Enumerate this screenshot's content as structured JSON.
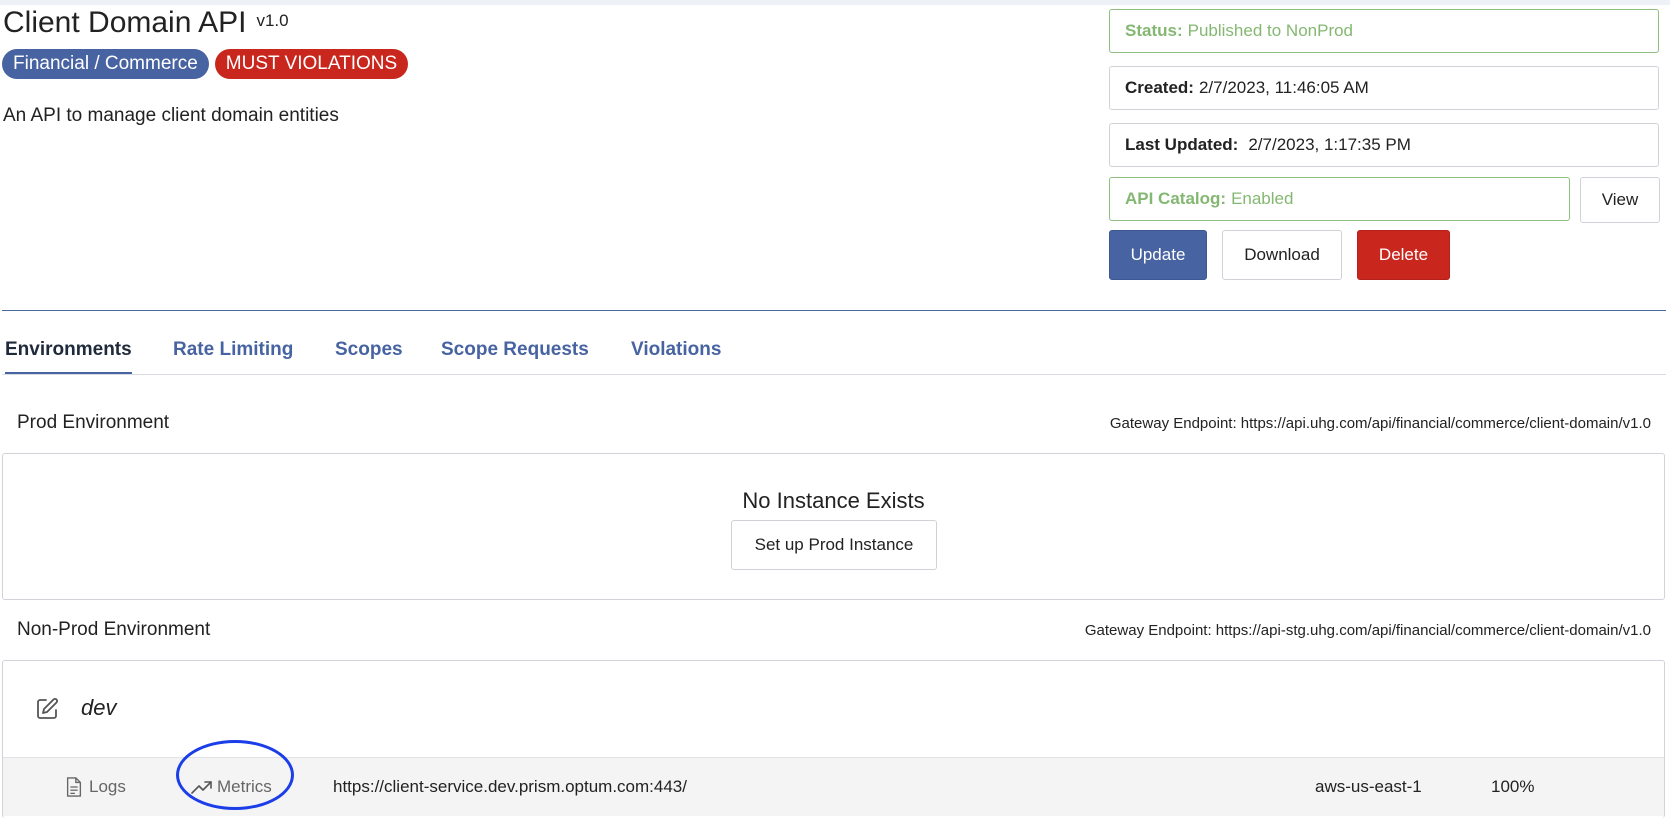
{
  "header": {
    "title": "Client Domain API",
    "version": "v1.0",
    "tags": [
      "Financial / Commerce",
      "MUST VIOLATIONS"
    ],
    "description": "An API to manage client domain entities"
  },
  "info": {
    "status_label": "Status:",
    "status_value": "Published to NonProd",
    "created_label": "Created:",
    "created_value": "2/7/2023, 11:46:05 AM",
    "updated_label": "Last Updated:",
    "updated_value": "2/7/2023, 1:17:35 PM",
    "catalog_label": "API Catalog:",
    "catalog_value": "Enabled",
    "view_label": "View"
  },
  "actions": {
    "update": "Update",
    "download": "Download",
    "delete": "Delete"
  },
  "tabs": [
    "Environments",
    "Rate Limiting",
    "Scopes",
    "Scope Requests",
    "Violations"
  ],
  "prod": {
    "title": "Prod Environment",
    "endpoint": "Gateway Endpoint: https://api.uhg.com/api/financial/commerce/client-domain/v1.0",
    "empty_text": "No Instance Exists",
    "setup_label": "Set up Prod Instance"
  },
  "nonprod": {
    "title": "Non-Prod Environment",
    "endpoint": "Gateway Endpoint: https://api-stg.uhg.com/api/financial/commerce/client-domain/v1.0",
    "instance_name": "dev",
    "logs_label": "Logs",
    "metrics_label": "Metrics",
    "url": "https://client-service.dev.prism.optum.com:443/",
    "region": "aws-us-east-1",
    "weight": "100%"
  },
  "colors": {
    "primary": "#4763a1",
    "danger": "#c9261e",
    "success": "#84b872",
    "annotation": "#1b3ee8"
  },
  "icons": [
    "pencil-square-icon",
    "document-icon",
    "trending-up-icon"
  ]
}
